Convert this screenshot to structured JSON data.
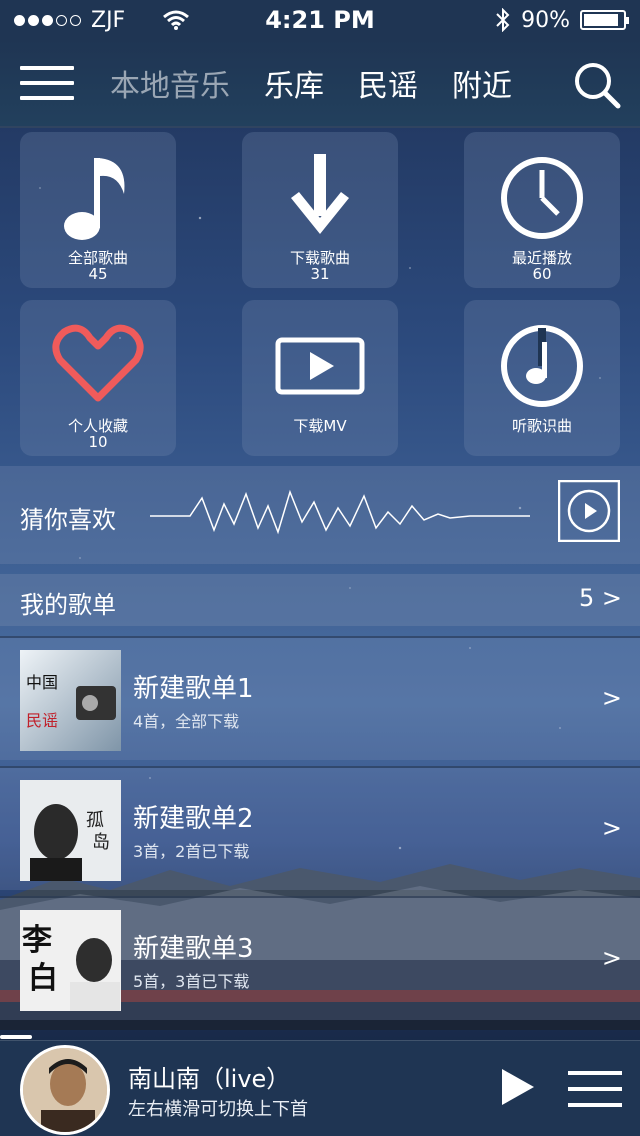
{
  "status_bar": {
    "carrier": "ZJF",
    "time": "4:21 PM",
    "battery": "90%",
    "signal_dots_filled": 3,
    "signal_dots_total": 5
  },
  "nav": {
    "tabs": [
      {
        "label": "本地音乐",
        "active": true
      },
      {
        "label": "乐库",
        "active": false
      },
      {
        "label": "民谣",
        "active": false
      },
      {
        "label": "附近",
        "active": false
      }
    ],
    "menu_icon": "hamburger-icon",
    "search_icon": "search-icon"
  },
  "grid": [
    {
      "label": "全部歌曲",
      "count": "45",
      "icon": "music-note-icon"
    },
    {
      "label": "下载歌曲",
      "count": "31",
      "icon": "download-arrow-icon"
    },
    {
      "label": "最近播放",
      "count": "60",
      "icon": "clock-icon"
    },
    {
      "label": "个人收藏",
      "count": "10",
      "icon": "heart-icon"
    },
    {
      "label": "下载MV",
      "count": "",
      "icon": "video-play-icon"
    },
    {
      "label": "听歌识曲",
      "count": "",
      "icon": "music-recognize-icon"
    }
  ],
  "guess": {
    "title": "猜你喜欢",
    "play_icon": "play-circle-icon"
  },
  "playlists": {
    "header": "我的歌单",
    "count": "5",
    "items": [
      {
        "name": "新建歌单1",
        "info": "4首，全部下载",
        "cover_text": "中国 民谣"
      },
      {
        "name": "新建歌单2",
        "info": "3首，2首已下载",
        "cover_text": "孤岛"
      },
      {
        "name": "新建歌单3",
        "info": "5首，3首已下载",
        "cover_text": "李白"
      }
    ],
    "arrow": ">"
  },
  "player": {
    "song": "南山南（live）",
    "hint": "左右横滑可切换上下首",
    "progress": 0.05
  },
  "colors": {
    "heart": "#ef5b5b",
    "bar_bg": "#1f3553",
    "inactive_tab": "#9aa6b4"
  }
}
